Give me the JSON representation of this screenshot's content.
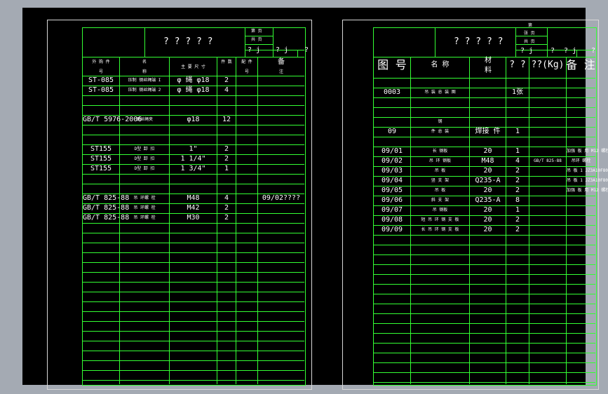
{
  "colors": {
    "background": "#a4aab3",
    "viewport": "#000000",
    "sheet_border": "#d8d8d8",
    "grid": "#33ff33",
    "text": "#ffffff"
  },
  "left": {
    "title": "? ? ? ? ?",
    "tb": {
      "a": "第  页",
      "b": "共  页",
      "c": "? j",
      "d": "? j",
      "e": "?"
    },
    "headers": {
      "h1": "外 购 件",
      "h1b": "号",
      "h2": "名",
      "h2b": "称",
      "h3": "主 要 尺 寸",
      "h4": "件 数",
      "h5": "配 件",
      "h5b": "号",
      "h6": "备",
      "h6b": "注"
    },
    "rows": [
      [
        "ST-085",
        "压制 钢丝绳端 I",
        "φ 绳 φ18",
        "2",
        "",
        ""
      ],
      [
        "ST-085",
        "压制 钢丝绳端 2",
        "φ 绳 φ18",
        "4",
        "",
        ""
      ],
      [
        "",
        "",
        "",
        "",
        "",
        ""
      ],
      [
        "",
        "",
        "",
        "",
        "",
        ""
      ],
      [
        "GB/T 5976-2006",
        "钢丝绳夹",
        "φ18",
        "12",
        "",
        ""
      ],
      [
        "",
        "",
        "",
        "",
        "",
        ""
      ],
      [
        "",
        "",
        "",
        "",
        "",
        ""
      ],
      [
        "ST155",
        "D型 卸 扣",
        "1\"",
        "2",
        "",
        ""
      ],
      [
        "ST155",
        "D型 卸 扣",
        "1 1/4\"",
        "2",
        "",
        ""
      ],
      [
        "ST155",
        "D型 卸 扣",
        "1 3/4\"",
        "1",
        "",
        ""
      ],
      [
        "",
        "",
        "",
        "",
        "",
        ""
      ],
      [
        "",
        "",
        "",
        "",
        "",
        ""
      ],
      [
        "GB/T 825-88",
        "吊 环螺 栓",
        "M48",
        "4",
        "",
        "09/02????"
      ],
      [
        "GB/T 825-88",
        "吊 环螺 栓",
        "M42",
        "2",
        "",
        ""
      ],
      [
        "GB/T 825-88",
        "吊 环螺 栓",
        "M30",
        "2",
        "",
        ""
      ]
    ]
  },
  "right": {
    "title": "? ? ? ? ?",
    "tb": {
      "a": "第",
      "b": "张 页",
      "c": "共 页",
      "d": "? j",
      "e": "?",
      "f": "? j",
      "g": "?"
    },
    "headers": {
      "h1": "图 号",
      "h2": "名  称",
      "h3": "材",
      "h3b": "料",
      "h4": "? ?",
      "h5": "??(Kg)",
      "h6": "备 注"
    },
    "rows": [
      [
        "",
        "",
        "",
        "",
        "",
        ""
      ],
      [
        "0003",
        "吊 装 总 装 图",
        "",
        "1张",
        "",
        ""
      ],
      [
        "",
        "",
        "",
        "",
        "",
        ""
      ],
      [
        "",
        "",
        "",
        "",
        "",
        ""
      ],
      [
        "",
        "钢",
        "",
        "",
        "",
        ""
      ],
      [
        "09",
        "件 总 装",
        "焊接 件",
        "1",
        "",
        ""
      ],
      [
        "",
        "",
        "",
        "",
        "",
        ""
      ],
      [
        "09/01",
        "长 钢板",
        "20",
        "1",
        "",
        "加强 板 用 M12 螺栓6/20"
      ],
      [
        "09/02",
        "吊 环 钢板",
        "M48",
        "4",
        "GB/T 825-88",
        "吊环 螺栓"
      ],
      [
        "09/03",
        "吊    板",
        "20",
        "2",
        "",
        "吊 板 1 JZ3A10F80"
      ],
      [
        "09/04",
        "竖 支 架",
        "Q235-A",
        "2",
        "",
        "吊 板 1 JZ3A10F80"
      ],
      [
        "09/05",
        "吊    板",
        "20",
        "2",
        "",
        "加强 板 用 M12 螺栓6/20"
      ],
      [
        "09/06",
        "斜 支 架",
        "Q235-A",
        "8",
        "",
        ""
      ],
      [
        "09/07",
        "吊 钢板",
        "20",
        "1",
        "",
        ""
      ],
      [
        "09/08",
        "短 吊 环 钢 支 板",
        "20",
        "2",
        "",
        ""
      ],
      [
        "09/09",
        "长 吊 环 钢 支 板",
        "20",
        "2",
        "",
        ""
      ]
    ]
  }
}
